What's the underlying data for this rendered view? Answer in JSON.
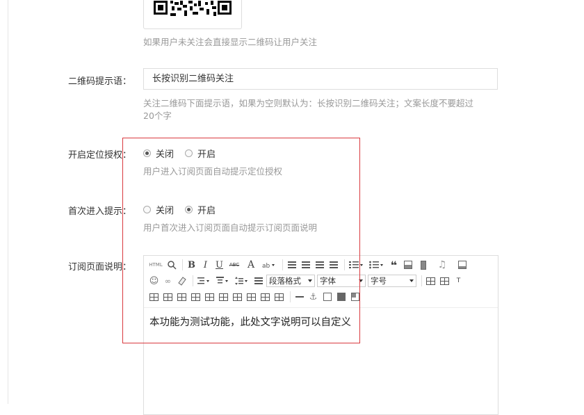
{
  "qr": {
    "help": "如果用户未关注会直接显示二维码让用户关注"
  },
  "qr_prompt": {
    "label": "二维码提示语：",
    "value": "长按识别二维码关注",
    "help_line1": "关注二维码下面提示语，如果为空则默认为：长按识别二维码关注；文案长度不要超过",
    "help_line2": "20个字"
  },
  "location": {
    "label": "开启定位授权：",
    "options": [
      "关闭",
      "开启"
    ],
    "selected": "关闭",
    "help": "用户进入订阅页面自动提示定位授权"
  },
  "first_visit": {
    "label": "首次进入提示：",
    "options": [
      "关闭",
      "开启"
    ],
    "selected": "开启",
    "help": "用户首次进入订阅页面自动提示订阅页面说明"
  },
  "description": {
    "label": "订阅页面说明：",
    "toolbar": {
      "html_label": "HTML",
      "bold": "B",
      "italic": "I",
      "underline": "U",
      "strike": "ABC",
      "font_color": "A",
      "paragraph_format": "段落格式",
      "font_family": "字体",
      "font_size": "字号",
      "quote": "❝"
    },
    "content": "本功能为测试功能，此处文字说明可以自定义"
  },
  "colors": {
    "highlight_border": "#d9393e",
    "help_text": "#999999",
    "border": "#dddddd"
  }
}
